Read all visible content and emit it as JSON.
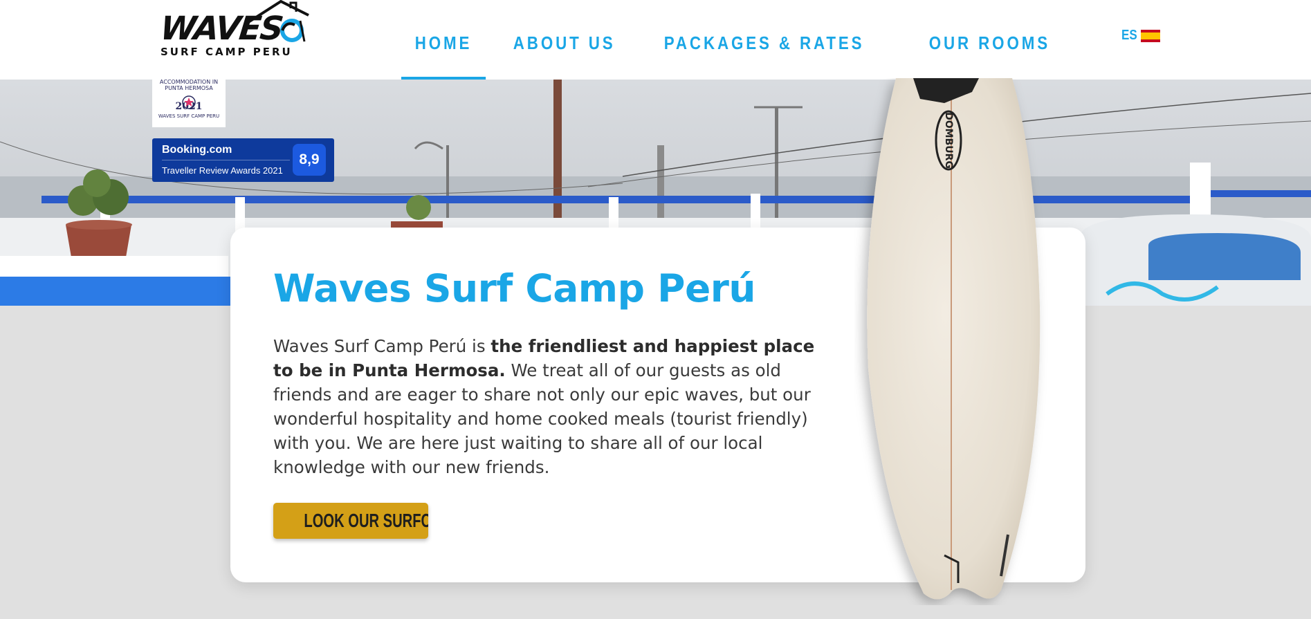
{
  "header": {
    "logo": {
      "main": "WAVES",
      "sub": "SURF CAMP PERU"
    },
    "nav": [
      {
        "label": "HOME",
        "active": true
      },
      {
        "label": "ABOUT US",
        "active": false
      },
      {
        "label": "PACKAGES & RATES",
        "active": false
      },
      {
        "label": "OUR ROOMS",
        "active": false
      }
    ],
    "language": {
      "code": "ES",
      "flag_icon": "spain-flag-icon"
    }
  },
  "badges": {
    "award": {
      "line1": "ACCOMMODATION IN",
      "line2": "PUNTA HERMOSA",
      "year": "2021",
      "footer": "WAVES SURF CAMP PERU"
    },
    "booking": {
      "brand": "Booking.com",
      "subtitle": "Traveller Review Awards 2021",
      "score": "8,9"
    }
  },
  "card": {
    "title": "Waves Surf Camp Perú",
    "intro": "Waves Surf Camp Perú is ",
    "highlight": "the friendliest and happiest place to be in Punta Hermosa.",
    "body": " We treat all of our guests as old friends and are eager to share not only our epic waves, but our wonderful hospitality and home cooked meals (tourist friendly) with you. We are here just waiting to share all of our local knowledge with our new friends.",
    "cta_label": "LOOK OUR SURFCAMP"
  },
  "surfboard": {
    "brand": "DOMBURG"
  },
  "colors": {
    "accent": "#1aa6e6",
    "cta": "#d4a017",
    "booking": "#0e3a9c",
    "page_bg": "#e0e0e0"
  }
}
